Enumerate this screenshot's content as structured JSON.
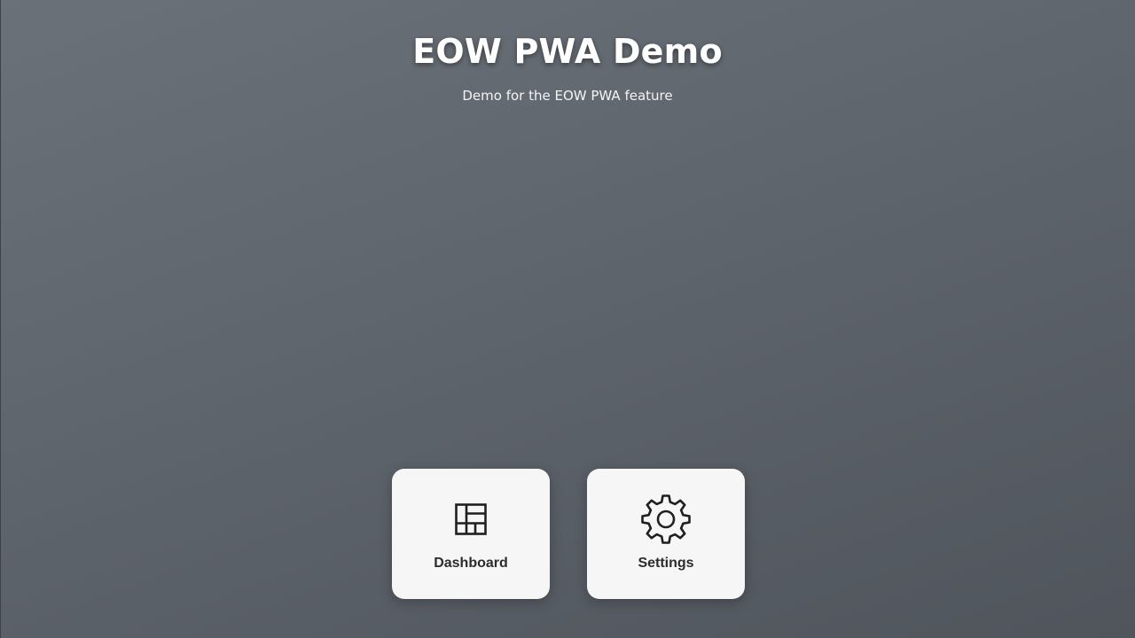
{
  "app": {
    "title": "EOW PWA Demo",
    "subtitle": "Demo for the EOW PWA feature"
  },
  "tiles": [
    {
      "label": "Dashboard",
      "icon": "dashboard-icon"
    },
    {
      "label": "Settings",
      "icon": "gear-icon"
    }
  ],
  "colors": {
    "background": "#60666e",
    "tile_background": "#f6f6f6",
    "text_dark": "#2c2c2c",
    "title": "#ffffff"
  }
}
